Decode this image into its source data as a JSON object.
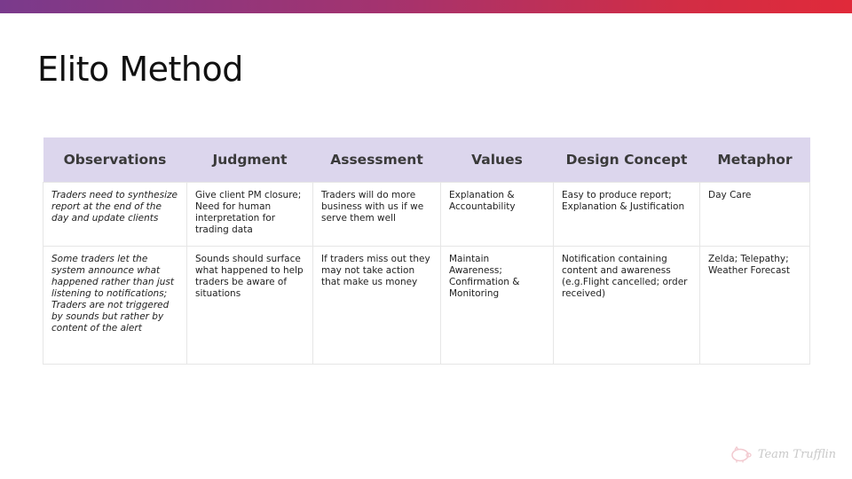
{
  "slide": {
    "title": "Elito Method"
  },
  "table": {
    "headers": [
      "Observations",
      "Judgment",
      "Assessment",
      "Values",
      "Design Concept",
      "Metaphor"
    ],
    "rows": [
      {
        "observations": "Traders need to synthesize report at the end of the day and update clients",
        "judgment": "Give client PM closure;\nNeed for human interpretation for trading data",
        "assessment": "Traders will do more business with us if we serve them well",
        "values": "Explanation & Accountability",
        "design_concept": "Easy to produce report;\nExplanation & Justification",
        "metaphor": "Day Care"
      },
      {
        "observations": "Some traders let the system announce what happened rather than just listening to notifications;\nTraders are not triggered by sounds but rather by content of the alert",
        "judgment": "Sounds should surface what happened to help traders be aware of situations",
        "assessment": "If traders miss out they may not take action that make us money",
        "values": "Maintain Awareness;\nConfirmation & Monitoring",
        "design_concept": "Notification containing content and awareness\n(e.g.Flight cancelled; order received)",
        "metaphor": "Zelda; Telepathy;\nWeather Forecast"
      }
    ]
  },
  "footer": {
    "logo_text": "Team Trufflin",
    "logo_icon": "pig-icon"
  },
  "colors": {
    "header_fill": "#dcd6ed",
    "top_bar_start": "#7a3a8c",
    "top_bar_end": "#e02a3a"
  }
}
